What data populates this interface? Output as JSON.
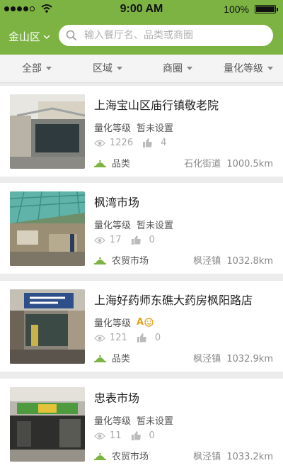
{
  "status_bar": {
    "time": "9:00 AM",
    "battery": "100%"
  },
  "header": {
    "region_label": "金山区",
    "search_placeholder": "输入餐厅名、品类或商圈"
  },
  "filters": [
    "全部",
    "区域",
    "商圈",
    "量化等级"
  ],
  "colors": {
    "brand": "#7cb342",
    "grade": "#e5a11b"
  },
  "listings": [
    {
      "title": "上海宝山区庙行镇敬老院",
      "level_label": "量化等级",
      "level_value": "暂未设置",
      "views": "1226",
      "likes": "4",
      "category": "品类",
      "location": "石化街道",
      "distance": "1000.5km"
    },
    {
      "title": "枫湾市场",
      "level_label": "量化等级",
      "level_value": "暂未设置",
      "views": "17",
      "likes": "0",
      "category": "农贸市场",
      "location": "枫泾镇",
      "distance": "1032.8km"
    },
    {
      "title": "上海好药师东礁大药房枫阳路店",
      "level_label": "量化等级",
      "level_value": "A",
      "views": "121",
      "likes": "0",
      "category": "品类",
      "location": "枫泾镇",
      "distance": "1032.9km"
    },
    {
      "title": "忠表市场",
      "level_label": "量化等级",
      "level_value": "暂未设置",
      "views": "11",
      "likes": "0",
      "category": "农贸市场",
      "location": "枫泾镇",
      "distance": "1033.2km"
    }
  ]
}
